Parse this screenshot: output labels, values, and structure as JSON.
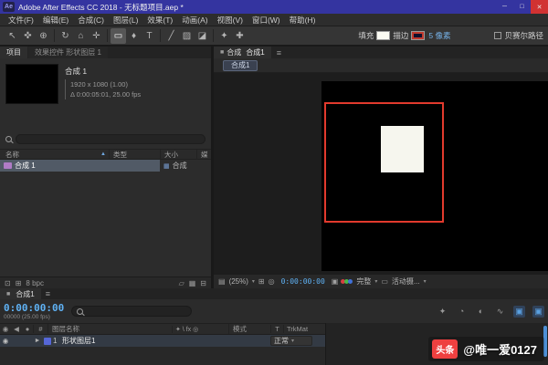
{
  "titlebar": {
    "app_icon": "Ae",
    "title": "Adobe After Effects CC 2018 - 无标题项目.aep *",
    "minimize": "─",
    "maximize": "□",
    "close": "✕"
  },
  "menubar": {
    "items": [
      "文件(F)",
      "编辑(E)",
      "合成(C)",
      "图层(L)",
      "效果(T)",
      "动画(A)",
      "视图(V)",
      "窗口(W)",
      "帮助(H)"
    ]
  },
  "toolbar": {
    "tools": [
      {
        "name": "selection-tool",
        "glyph": "↖"
      },
      {
        "name": "hand-tool",
        "glyph": "✜"
      },
      {
        "name": "zoom-tool",
        "glyph": "⊕"
      },
      {
        "name": "rotation-tool",
        "glyph": "↻"
      },
      {
        "name": "camera-tool",
        "glyph": "⌂"
      },
      {
        "name": "pan-behind-tool",
        "glyph": "✛"
      },
      {
        "name": "shape-tool",
        "glyph": "▭"
      },
      {
        "name": "pen-tool",
        "glyph": "♦"
      },
      {
        "name": "type-tool",
        "glyph": "T"
      },
      {
        "name": "brush-tool",
        "glyph": "╱"
      },
      {
        "name": "clone-stamp-tool",
        "glyph": "▨"
      },
      {
        "name": "eraser-tool",
        "glyph": "◪"
      },
      {
        "name": "roto-brush-tool",
        "glyph": "✦"
      },
      {
        "name": "puppet-pin-tool",
        "glyph": "✚"
      }
    ],
    "fill_label": "填充",
    "stroke_label": "描边",
    "stroke_width": "5 像素",
    "bezier_label": "贝赛尔路径"
  },
  "project_panel": {
    "tabs": [
      {
        "label": "项目"
      },
      {
        "label": "效果控件 形状图层 1"
      }
    ],
    "preview": {
      "comp_name": "合成 1",
      "resolution": "1920 x 1080 (1.00)",
      "duration": "Δ 0:00:05:01, 25.00 fps"
    },
    "columns": [
      "名称",
      "类型",
      "大小",
      "媒"
    ],
    "rows": [
      {
        "name": "合成 1",
        "type": "合成"
      }
    ],
    "bit_depth": "8 bpc"
  },
  "viewer": {
    "panel_title": "合成",
    "tab": "合成1",
    "breadcrumb": "合成1",
    "zoom": "(25%)",
    "timecode": "0:00:00:00",
    "resolution": "完整",
    "camera": "活动摄..."
  },
  "timeline": {
    "tab": "合成1",
    "timecode": "0:00:00:00",
    "frame_info": "00000 (25.00 fps)",
    "columns": {
      "layer_name": "图层名称",
      "switches": "✦ \\ fx ◎",
      "mode": "模式",
      "t": "T",
      "trkmat": "TrkMat"
    },
    "layers": [
      {
        "index": "1",
        "name": "形状图层1",
        "mode": "正常"
      }
    ]
  },
  "watermark": {
    "badge": "头条",
    "handle": "@唯一爱0127"
  },
  "icons": {
    "panel_menu": "≡",
    "chevron_down": "▾",
    "sort_asc": "▲",
    "panel_box": "■",
    "eye": "◉",
    "audio": "◀",
    "solo": "●",
    "hash": "#",
    "twirl": "►",
    "comp_type": "▦",
    "folder": "▱",
    "new_comp": "▦",
    "trash": "⊟",
    "grid": "▤",
    "safe_zones": "⊞",
    "mask": "◎",
    "snapshot": "▣",
    "roi": "▭",
    "shy": "✦",
    "frame_blend": "◔",
    "motion_blur": "◐",
    "graph": "∿",
    "blue_box": "▣",
    "left_icon_a": "⊡",
    "left_icon_b": "⊞"
  },
  "colors": {
    "titlebar_blue": "#3434a0",
    "shape_stroke_red": "#e23a2d",
    "shape_fill_white": "#f6f6ee",
    "timecode_blue": "#5fb2f5",
    "layer_label_blue": "#5667d8",
    "toutiao_red": "#ee4040"
  }
}
